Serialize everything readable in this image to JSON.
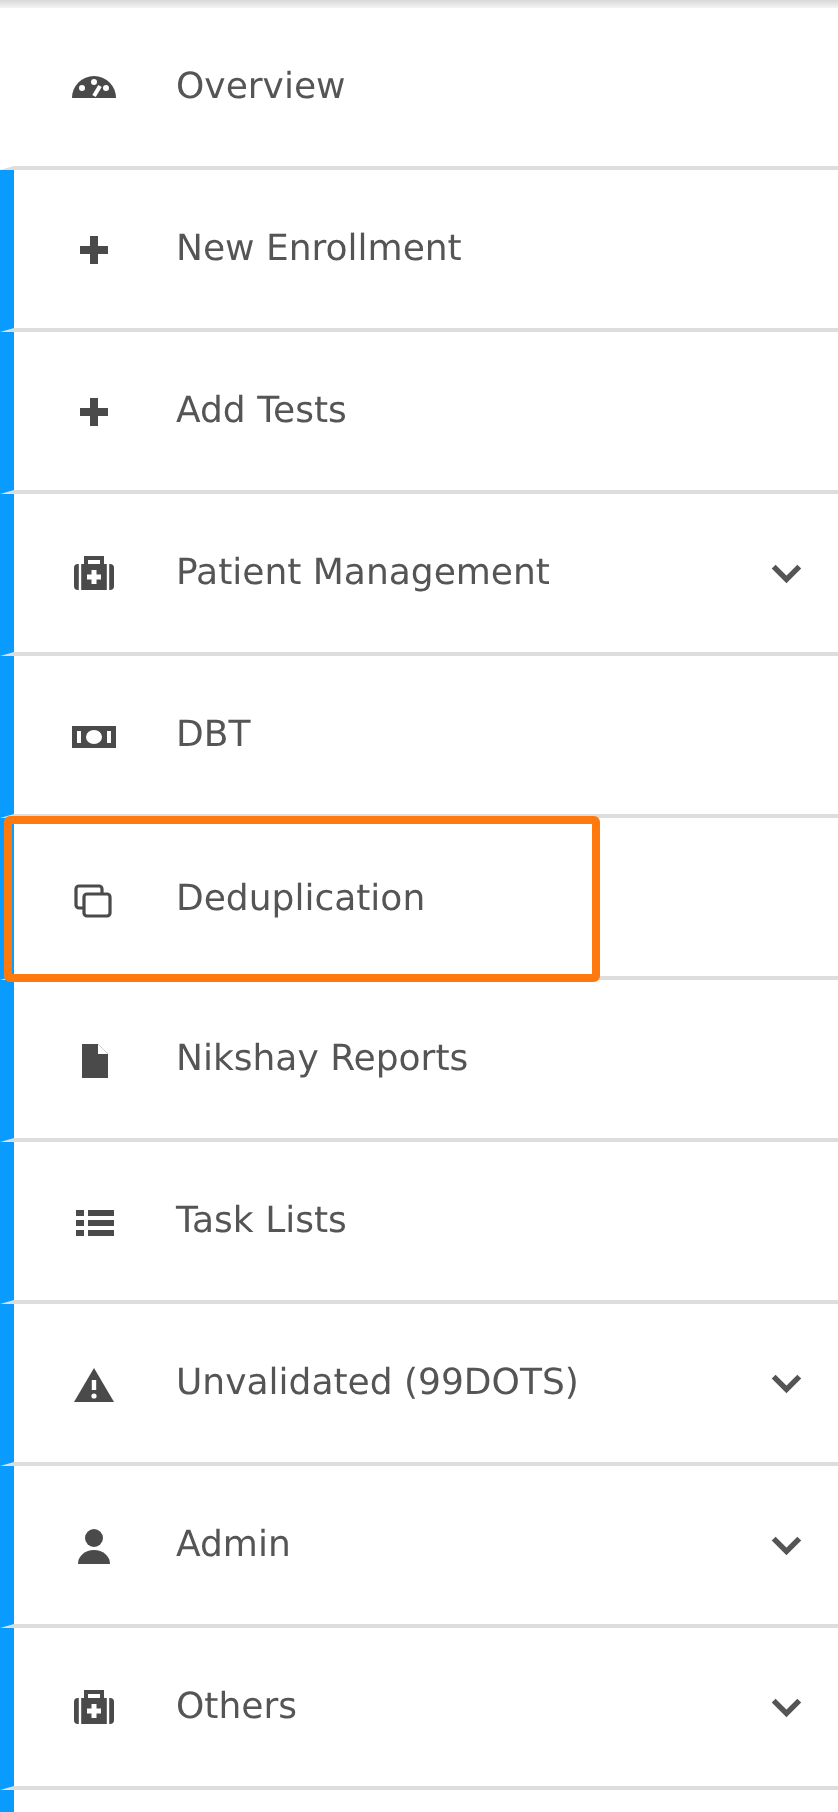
{
  "menu": {
    "items": [
      {
        "label": "Overview",
        "expandable": false,
        "highlighted": false,
        "accent": false
      },
      {
        "label": "New Enrollment",
        "expandable": false,
        "highlighted": false,
        "accent": true
      },
      {
        "label": "Add Tests",
        "expandable": false,
        "highlighted": false,
        "accent": true
      },
      {
        "label": "Patient Management",
        "expandable": true,
        "highlighted": false,
        "accent": true
      },
      {
        "label": "DBT",
        "expandable": false,
        "highlighted": false,
        "accent": true
      },
      {
        "label": "Deduplication",
        "expandable": false,
        "highlighted": true,
        "accent": true
      },
      {
        "label": "Nikshay Reports",
        "expandable": false,
        "highlighted": false,
        "accent": true
      },
      {
        "label": "Task Lists",
        "expandable": false,
        "highlighted": false,
        "accent": true
      },
      {
        "label": "Unvalidated (99DOTS)",
        "expandable": true,
        "highlighted": false,
        "accent": true
      },
      {
        "label": "Admin",
        "expandable": true,
        "highlighted": false,
        "accent": true
      },
      {
        "label": "Others",
        "expandable": true,
        "highlighted": false,
        "accent": true
      }
    ]
  }
}
